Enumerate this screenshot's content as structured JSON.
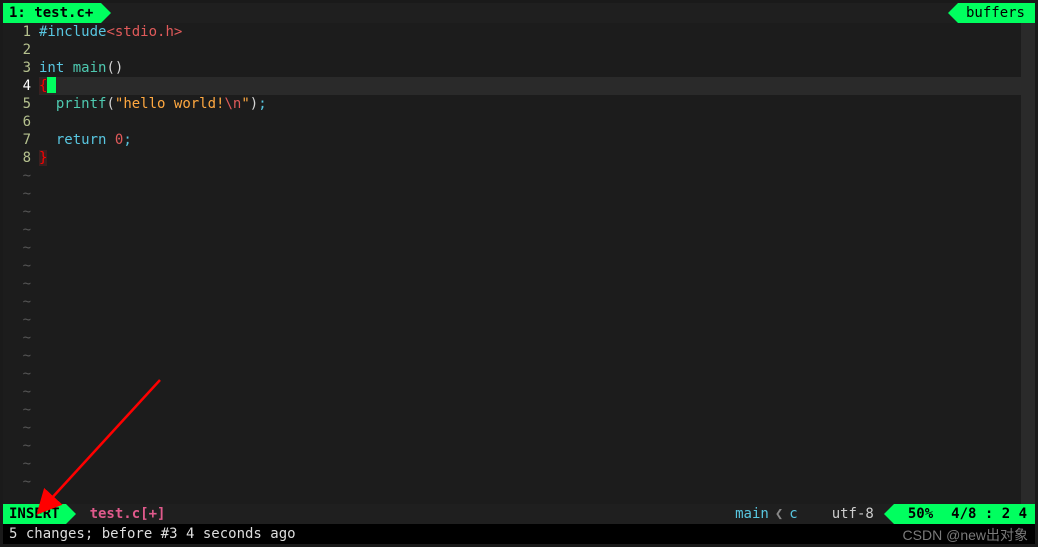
{
  "tabbar": {
    "left_label": "1: test.c+",
    "right_label": "buffers"
  },
  "gutter": {
    "lines": [
      "1",
      "2",
      "3",
      "4",
      "5",
      "6",
      "7",
      "8"
    ],
    "current": 4
  },
  "code": {
    "l1": {
      "include": "#include",
      "header": "<stdio.h>"
    },
    "l3": {
      "int": "int",
      "main": " main",
      "paren": "()"
    },
    "l4": {
      "brace": "{"
    },
    "l5": {
      "indent": "  ",
      "printf": "printf",
      "open": "(",
      "q1": "\"",
      "str": "hello world!",
      "esc": "\\n",
      "q2": "\"",
      "close": ")",
      "semi": ";"
    },
    "l7": {
      "indent": "  ",
      "return": "return ",
      "zero": "0",
      "semi": ";"
    },
    "l8": {
      "brace": "}"
    },
    "tilde": "~"
  },
  "status": {
    "mode": "INSERT",
    "filename": "test.c[+]",
    "git_branch": "main",
    "git_ft": "c",
    "encoding": "utf-8",
    "percent": "50%",
    "position": "4/8 :  2 4"
  },
  "message": "5 changes; before #3  4 seconds ago",
  "watermark": "CSDN @new出对象"
}
